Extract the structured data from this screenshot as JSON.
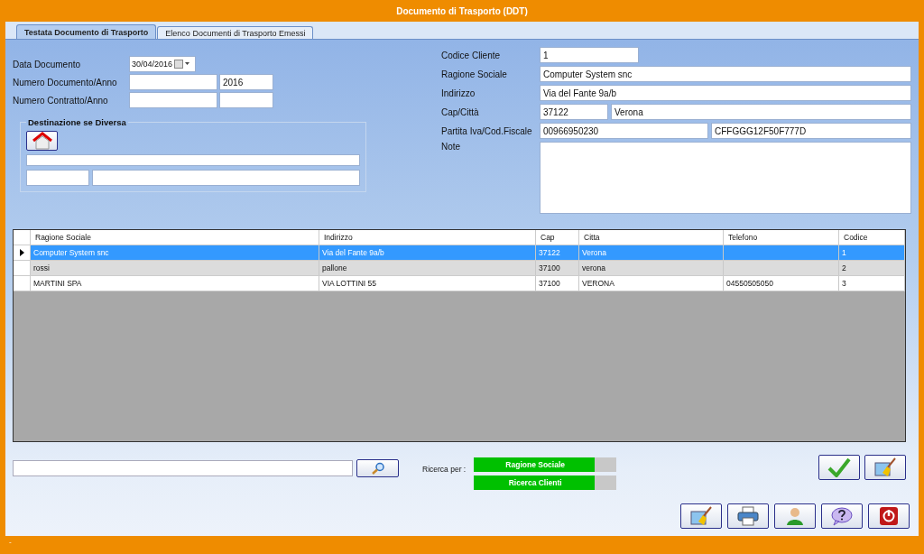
{
  "window": {
    "title": "Documento di Trasporto  (DDT)"
  },
  "tabs": [
    {
      "label": "Testata Documento di Trasporto",
      "selected": true
    },
    {
      "label": "Elenco Documenti di Trasporto Emessi",
      "selected": false
    }
  ],
  "document": {
    "date_label": "Data Documento",
    "date": "30/04/2016",
    "number_label": "Numero  Documento/Anno",
    "year": "2016",
    "contract_label": "Numero  Contratto/Anno"
  },
  "destination": {
    "title": "Destinazione se Diversa"
  },
  "customer": {
    "code_label": "Codice Cliente",
    "code": "1",
    "name_label": "Ragione Sociale",
    "name": "Computer System snc",
    "address_label": "Indirizzo",
    "address": "Via del Fante 9a/b",
    "city_label": "Cap/Città",
    "zip": "37122",
    "city": "Verona",
    "tax_label": "Partita Iva/Cod.Fiscale",
    "vat": "00966950230",
    "fiscal_code": "CFFGGG12F50F777D",
    "notes_label": "Note"
  },
  "table": {
    "columns": [
      "Ragione Sociale",
      "Indirizzo",
      "Cap",
      "Citta",
      "Telefono",
      "Codice"
    ],
    "rows": [
      {
        "cells": [
          "Computer System snc",
          "Via del Fante 9a/b",
          "37122",
          "Verona",
          "",
          "1"
        ],
        "selected": true
      },
      {
        "cells": [
          "rossi",
          "pallone",
          "37100",
          "verona",
          "",
          "2"
        ],
        "selected": false
      },
      {
        "cells": [
          "MARTINI SPA",
          "VIA LOTTINI 55",
          "37100",
          "VERONA",
          "04550505050",
          "3"
        ],
        "selected": false
      }
    ]
  },
  "search": {
    "label": "Ricerca per :",
    "options": [
      "Ragione Sociale",
      "Ricerca Clienti"
    ]
  },
  "status_bar": "-"
}
